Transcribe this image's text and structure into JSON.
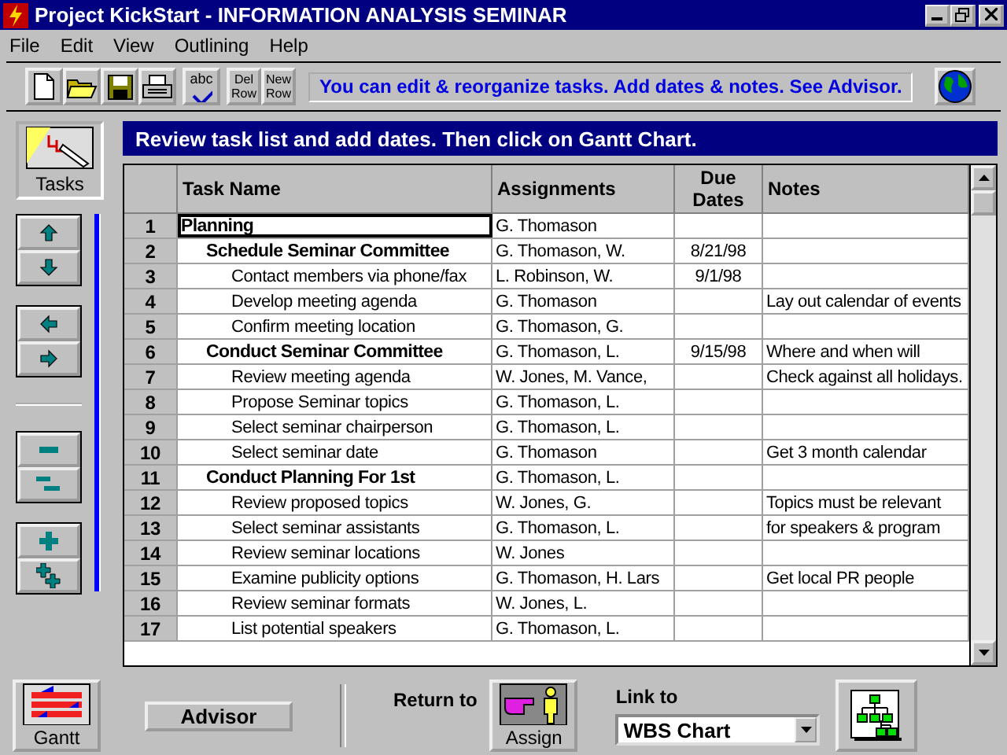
{
  "window": {
    "title": "Project KickStart - INFORMATION ANALYSIS SEMINAR"
  },
  "menu": [
    "File",
    "Edit",
    "View",
    "Outlining",
    "Help"
  ],
  "toolbar": {
    "buttons": [
      {
        "kind": "new"
      },
      {
        "kind": "open"
      },
      {
        "kind": "save"
      },
      {
        "kind": "print"
      },
      {
        "kind": "spell",
        "label": "abc"
      },
      {
        "kind": "text",
        "label": "Del Row"
      },
      {
        "kind": "text",
        "label": "New Row"
      }
    ],
    "hint": "You can edit & reorganize tasks.  Add dates & notes.  See Advisor."
  },
  "side": {
    "tasks_label": "Tasks"
  },
  "instruction": "Review task list and add dates.  Then click on Gantt Chart.",
  "table": {
    "columns": [
      "Task Name",
      "Assignments",
      "Due Dates",
      "Notes"
    ],
    "rows": [
      {
        "num": "1",
        "task": "Planning",
        "assign": "G. Thomason",
        "selected": true,
        "children": [
          {
            "num": "2",
            "task": "Schedule Seminar Committee",
            "assign": "G. Thomason, W.",
            "due": "8/21/98",
            "selected": false,
            "children": [
              {
                "num": "3",
                "task": "Contact members via phone/fax",
                "assign": "L. Robinson, W.",
                "due": "9/1/98",
                "selected": false
              },
              {
                "num": "4",
                "task": "Develop meeting agenda",
                "assign": "G. Thomason",
                "notes": "Lay out calendar of events",
                "selected": false
              },
              {
                "num": "5",
                "task": "Confirm meeting location",
                "assign": "G. Thomason, G.",
                "selected": false
              }
            ]
          },
          {
            "num": "6",
            "task": "Conduct Seminar Committee",
            "assign": "G. Thomason, L.",
            "due": "9/15/98",
            "notes": "Where and when will",
            "selected": false,
            "children": [
              {
                "num": "7",
                "task": "Review meeting agenda",
                "assign": "W. Jones, M. Vance,",
                "notes": "Check against all holidays.",
                "selected": false
              },
              {
                "num": "8",
                "task": "Propose Seminar topics",
                "assign": "G. Thomason, L.",
                "selected": false
              },
              {
                "num": "9",
                "task": "Select seminar chairperson",
                "assign": "G. Thomason, L.",
                "selected": false
              },
              {
                "num": "10",
                "task": "Select seminar date",
                "assign": "G. Thomason",
                "notes": "Get 3 month calendar",
                "selected": false
              }
            ]
          },
          {
            "num": "11",
            "task": "Conduct Planning For 1st",
            "assign": "G. Thomason, L.",
            "selected": false,
            "children": [
              {
                "num": "12",
                "task": "Review proposed topics",
                "assign": "W. Jones, G.",
                "notes": "Topics must be relevant",
                "selected": false
              },
              {
                "num": "13",
                "task": "Select seminar assistants",
                "assign": "G. Thomason, L.",
                "notes": "for speakers & program",
                "selected": false
              },
              {
                "num": "14",
                "task": "Review seminar locations",
                "assign": "W. Jones",
                "selected": false
              },
              {
                "num": "15",
                "task": "Examine publicity options",
                "assign": "G. Thomason, H. Lars",
                "notes": "Get local PR people",
                "selected": false
              },
              {
                "num": "16",
                "task": "Review seminar formats",
                "assign": "W. Jones, L.",
                "selected": false
              },
              {
                "num": "17",
                "task": "List potential speakers",
                "assign": "G. Thomason, L.",
                "selected": false
              }
            ]
          }
        ]
      }
    ]
  },
  "bottom": {
    "gantt_label": "Gantt",
    "advisor": "Advisor",
    "return_to": "Return to",
    "assign_label": "Assign",
    "link_to": "Link to",
    "link_value": "WBS Chart"
  }
}
